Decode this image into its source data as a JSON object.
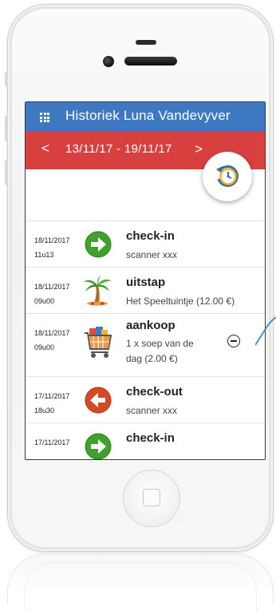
{
  "app": {
    "title": "Historiek Luna Vandevyver",
    "menu_icon": "grid-icon"
  },
  "week": {
    "prev_label": "<",
    "range": "13/11/17 - 19/11/17",
    "next_label": ">"
  },
  "fab_icon": "history-clock-icon",
  "colors": {
    "app_bar": "#3d78c0",
    "week_bar": "#d84040",
    "check_in": "#3ea22c",
    "check_out": "#d44a22",
    "pointer": "#4a90c8"
  },
  "entries": [
    {
      "date": "18/11/2017",
      "time": "11u13",
      "title": "check-in",
      "subtitle": "scanner xxx",
      "icon": "arrow-right-icon"
    },
    {
      "date": "18/11/2017",
      "time": "09u00",
      "title": "uitstap",
      "subtitle": "Het Speeltuintje (12.00 €)",
      "icon": "palm-tree-icon"
    },
    {
      "date": "18/11/2017",
      "time": "09u00",
      "title": "aankoop",
      "subtitle_line1": "1 x soep van de",
      "subtitle_line2": "dag (2.00 €)",
      "icon": "shopping-cart-icon",
      "action_icon": "remove-circle-icon"
    },
    {
      "date": "17/11/2017",
      "time": "18u30",
      "title": "check-out",
      "subtitle": "scanner xxx",
      "icon": "arrow-left-icon"
    },
    {
      "date": "17/11/2017",
      "time": "",
      "title": "check-in",
      "subtitle": "",
      "icon": "arrow-right-icon"
    }
  ]
}
